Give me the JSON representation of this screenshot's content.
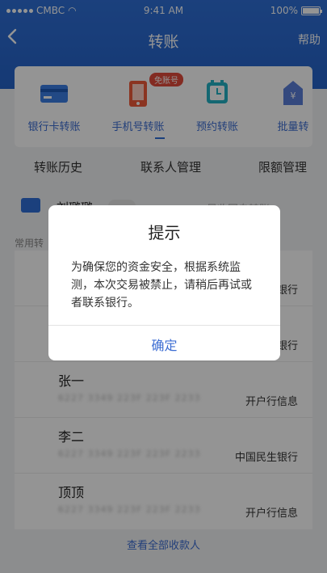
{
  "status_bar": {
    "carrier": "CMBC",
    "time": "9:41 AM",
    "battery": "100%"
  },
  "nav": {
    "back_icon": "chevron-left",
    "title": "转账",
    "help": "帮助"
  },
  "quick_actions": [
    {
      "label": "银行卡转账",
      "icon": "card-icon"
    },
    {
      "label": "手机号转账",
      "icon": "phone-icon",
      "badge": "免账号"
    },
    {
      "label": "预约转账",
      "icon": "clock-icon"
    },
    {
      "label": "批量转",
      "icon": "batch-icon"
    }
  ],
  "tabs": [
    "转账历史",
    "联系人管理",
    "限额管理"
  ],
  "partner": {
    "name": "刘璐璐",
    "right": "目收回自转账"
  },
  "common_label": "常用转",
  "payees": [
    {
      "name": "",
      "account": "",
      "bank": "银行"
    },
    {
      "name": "",
      "account": "",
      "bank": "银行"
    },
    {
      "name": "张一",
      "account": "6227 3349 223F 223F 2233",
      "bank": "开户行信息"
    },
    {
      "name": "李二",
      "account": "6227 3349 223F 223F 2233",
      "bank": "中国民生银行"
    },
    {
      "name": "顶顶",
      "account": "6227 3349 223F 223F 2233",
      "bank": "开户行信息"
    }
  ],
  "view_all": "查看全部收款人",
  "dialog": {
    "title": "提示",
    "message": "为确保您的资金安全，根据系统监测，本次交易被禁止，请稍后再试或者联系银行。",
    "confirm": "确定"
  },
  "colors": {
    "brand": "#2f6fd7",
    "accent": "#3c6dd3",
    "badge": "#e24a3b"
  }
}
